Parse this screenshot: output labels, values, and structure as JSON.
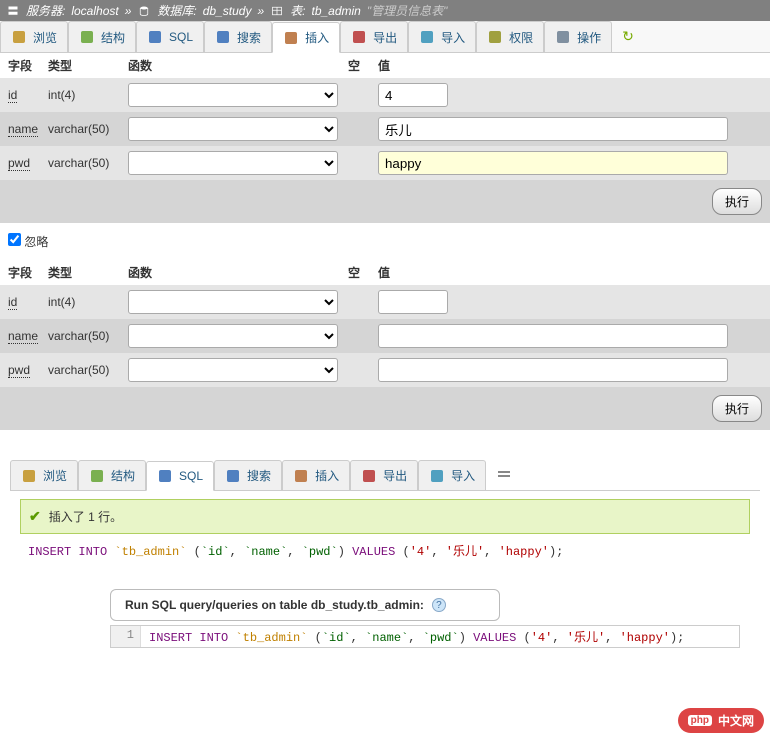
{
  "breadcrumb": {
    "server_label": "服务器:",
    "server": "localhost",
    "db_label": "数据库:",
    "db": "db_study",
    "table_label": "表:",
    "table": "tb_admin",
    "comment": "\"管理员信息表\""
  },
  "tabs": [
    "浏览",
    "结构",
    "SQL",
    "搜索",
    "插入",
    "导出",
    "导入",
    "权限",
    "操作"
  ],
  "active_tab_index": 4,
  "headers": {
    "field": "字段",
    "type": "类型",
    "func": "函数",
    "null": "空",
    "value": "值"
  },
  "rows1": [
    {
      "field": "id",
      "type": "int(4)",
      "func": "",
      "value": "4",
      "short": true,
      "highlight": false
    },
    {
      "field": "name",
      "type": "varchar(50)",
      "func": "",
      "value": "乐儿",
      "short": false,
      "highlight": false
    },
    {
      "field": "pwd",
      "type": "varchar(50)",
      "func": "",
      "value": "happy",
      "short": false,
      "highlight": true
    }
  ],
  "rows2": [
    {
      "field": "id",
      "type": "int(4)",
      "func": "",
      "value": "",
      "short": true,
      "highlight": false
    },
    {
      "field": "name",
      "type": "varchar(50)",
      "func": "",
      "value": "",
      "short": false,
      "highlight": false
    },
    {
      "field": "pwd",
      "type": "varchar(50)",
      "func": "",
      "value": "",
      "short": false,
      "highlight": false
    }
  ],
  "exec_label": "执行",
  "ignore_label": "忽略",
  "ignore_checked": true,
  "lower_tabs": [
    "浏览",
    "结构",
    "SQL",
    "搜索",
    "插入",
    "导出",
    "导入"
  ],
  "lower_active_index": 2,
  "success_msg": "插入了 1 行。",
  "sql_preview": "INSERT INTO `tb_admin` (`id`, `name`, `pwd`) VALUES ('4', '乐儿', 'happy');",
  "sqlbox_text": "Run SQL query/queries on table db_study.tb_admin:",
  "editor_line": "1",
  "editor_sql": "INSERT INTO `tb_admin` (`id`, `name`, `pwd`) VALUES ('4', '乐儿', 'happy');",
  "watermark": "中文网"
}
